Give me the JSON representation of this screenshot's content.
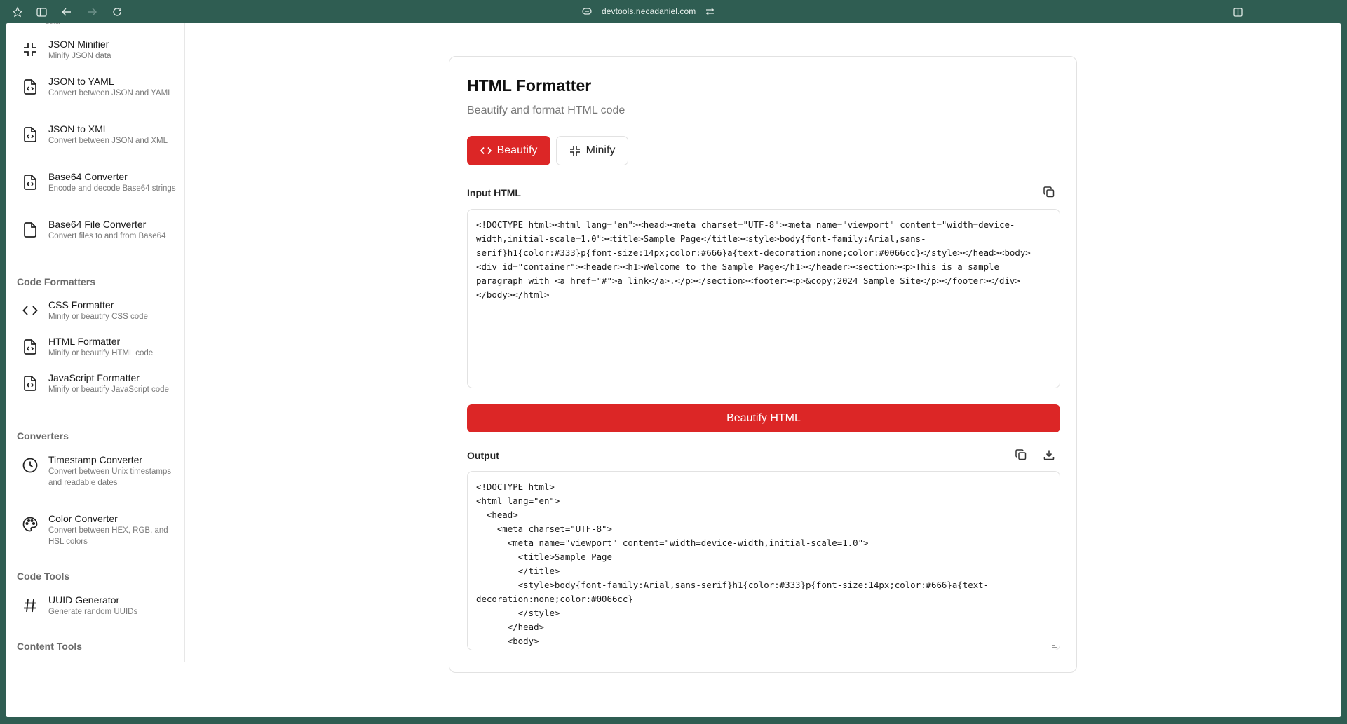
{
  "browser": {
    "url": "devtools.necadaniel.com"
  },
  "sidebar": {
    "cut_text": "data",
    "items_top": [
      {
        "title": "JSON Minifier",
        "desc": "Minify JSON data",
        "icon": "minify-icon"
      },
      {
        "title": "JSON to YAML",
        "desc": "Convert between JSON and YAML",
        "icon": "file-code-icon"
      },
      {
        "title": "JSON to XML",
        "desc": "Convert between JSON and XML",
        "icon": "file-code-icon"
      },
      {
        "title": "Base64 Converter",
        "desc": "Encode and decode Base64 strings",
        "icon": "file-code-icon"
      },
      {
        "title": "Base64 File Converter",
        "desc": "Convert files to and from Base64",
        "icon": "file-icon"
      }
    ],
    "section_code_formatters": "Code Formatters",
    "items_formatters": [
      {
        "title": "CSS Formatter",
        "desc": "Minify or beautify CSS code",
        "icon": "code-brackets-icon"
      },
      {
        "title": "HTML Formatter",
        "desc": "Minify or beautify HTML code",
        "icon": "file-code-icon"
      },
      {
        "title": "JavaScript Formatter",
        "desc": "Minify or beautify JavaScript code",
        "icon": "file-code-icon"
      }
    ],
    "section_converters": "Converters",
    "items_converters": [
      {
        "title": "Timestamp Converter",
        "desc": "Convert between Unix timestamps and readable dates",
        "icon": "clock-icon"
      },
      {
        "title": "Color Converter",
        "desc": "Convert between HEX, RGB, and HSL colors",
        "icon": "palette-icon"
      }
    ],
    "section_code_tools": "Code Tools",
    "items_code_tools": [
      {
        "title": "UUID Generator",
        "desc": "Generate random UUIDs",
        "icon": "hash-icon"
      }
    ],
    "section_content_tools": "Content Tools"
  },
  "main": {
    "title": "HTML Formatter",
    "subtitle": "Beautify and format HTML code",
    "beautify_label": "Beautify",
    "minify_label": "Minify",
    "input_label": "Input HTML",
    "input_value": "<!DOCTYPE html><html lang=\"en\"><head><meta charset=\"UTF-8\"><meta name=\"viewport\" content=\"width=device-width,initial-scale=1.0\"><title>Sample Page</title><style>body{font-family:Arial,sans-serif}h1{color:#333}p{font-size:14px;color:#666}a{text-decoration:none;color:#0066cc}</style></head><body><div id=\"container\"><header><h1>Welcome to the Sample Page</h1></header><section><p>This is a sample paragraph with <a href=\"#\">a link</a>.</p></section><footer><p>&copy;2024 Sample Site</p></footer></div></body></html>",
    "action_label": "Beautify HTML",
    "output_label": "Output",
    "output_value": "<!DOCTYPE html>\n<html lang=\"en\">\n  <head>\n    <meta charset=\"UTF-8\">\n      <meta name=\"viewport\" content=\"width=device-width,initial-scale=1.0\">\n        <title>Sample Page\n        </title>\n        <style>body{font-family:Arial,sans-serif}h1{color:#333}p{font-size:14px;color:#666}a{text-decoration:none;color:#0066cc}\n        </style>\n      </head>\n      <body>"
  },
  "colors": {
    "accent": "#dc2626",
    "chrome": "#2f5d52"
  }
}
